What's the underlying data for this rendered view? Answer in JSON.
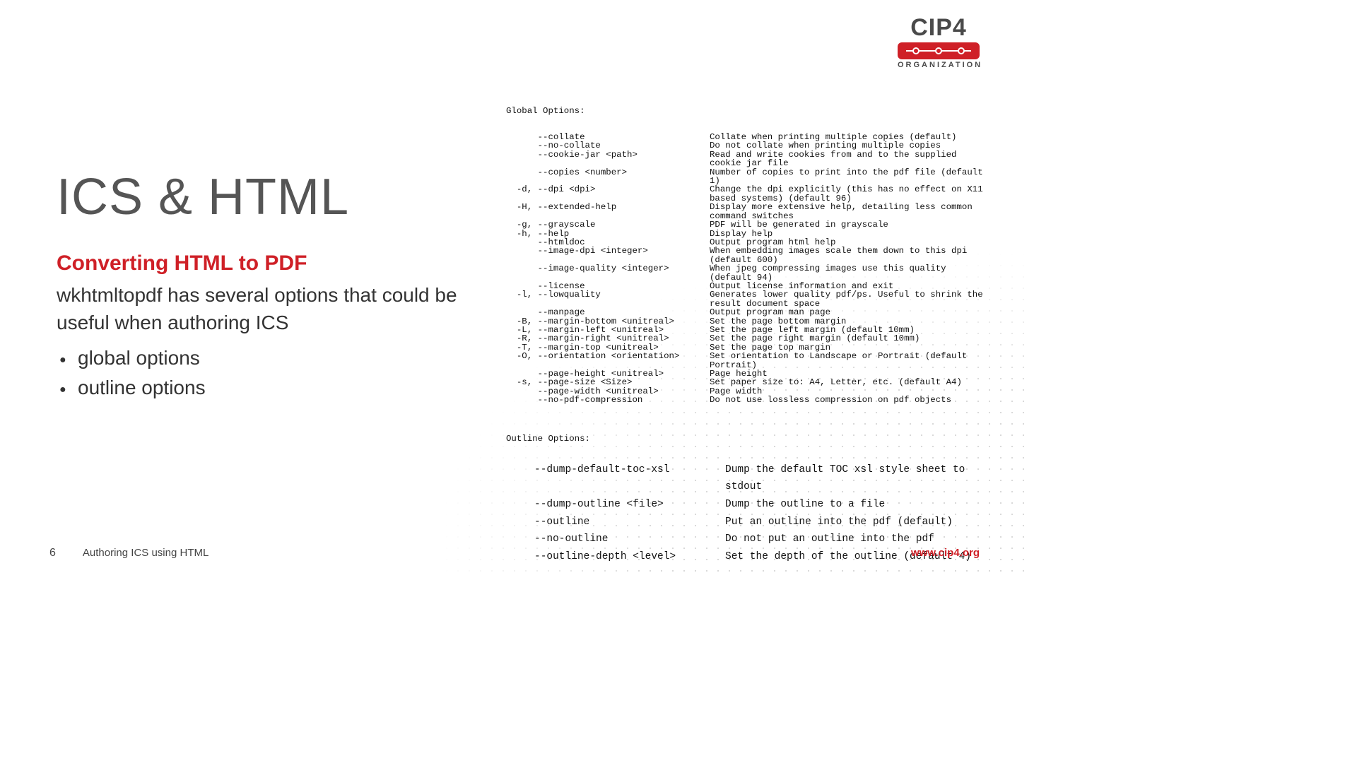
{
  "logo": {
    "top": "CIP4",
    "bottom": "ORGANIZATION"
  },
  "title": "ICS & HTML",
  "subtitle": "Converting HTML to PDF",
  "description": "wkhtmltopdf has several options that could be useful when authoring ICS",
  "bullets": [
    "global options",
    "outline options"
  ],
  "global_header": "Global Options:",
  "global_options": [
    {
      "sw": "      --collate",
      "ds": "Collate when printing multiple copies (default)"
    },
    {
      "sw": "      --no-collate",
      "ds": "Do not collate when printing multiple copies"
    },
    {
      "sw": "      --cookie-jar <path>",
      "ds": "Read and write cookies from and to the supplied cookie jar file"
    },
    {
      "sw": "      --copies <number>",
      "ds": "Number of copies to print into the pdf file (default 1)"
    },
    {
      "sw": "  -d, --dpi <dpi>",
      "ds": "Change the dpi explicitly (this has no effect on X11 based systems) (default 96)"
    },
    {
      "sw": "  -H, --extended-help",
      "ds": "Display more extensive help, detailing less common command switches"
    },
    {
      "sw": "  -g, --grayscale",
      "ds": "PDF will be generated in grayscale"
    },
    {
      "sw": "  -h, --help",
      "ds": "Display help"
    },
    {
      "sw": "      --htmldoc",
      "ds": "Output program html help"
    },
    {
      "sw": "      --image-dpi <integer>",
      "ds": "When embedding images scale them down to this dpi (default 600)"
    },
    {
      "sw": "      --image-quality <integer>",
      "ds": "When jpeg compressing images use this quality (default 94)"
    },
    {
      "sw": "      --license",
      "ds": "Output license information and exit"
    },
    {
      "sw": "  -l, --lowquality",
      "ds": "Generates lower quality pdf/ps. Useful to shrink the result document space"
    },
    {
      "sw": "      --manpage",
      "ds": "Output program man page"
    },
    {
      "sw": "  -B, --margin-bottom <unitreal>",
      "ds": "Set the page bottom margin"
    },
    {
      "sw": "  -L, --margin-left <unitreal>",
      "ds": "Set the page left margin (default 10mm)"
    },
    {
      "sw": "  -R, --margin-right <unitreal>",
      "ds": "Set the page right margin (default 10mm)"
    },
    {
      "sw": "  -T, --margin-top <unitreal>",
      "ds": "Set the page top margin"
    },
    {
      "sw": "  -O, --orientation <orientation>",
      "ds": "Set orientation to Landscape or Portrait (default Portrait)"
    },
    {
      "sw": "      --page-height <unitreal>",
      "ds": "Page height"
    },
    {
      "sw": "  -s, --page-size <Size>",
      "ds": "Set paper size to: A4, Letter, etc. (default A4)"
    },
    {
      "sw": "      --page-width <unitreal>",
      "ds": "Page width"
    },
    {
      "sw": "      --no-pdf-compression",
      "ds": "Do not use lossless compression on pdf objects"
    }
  ],
  "outline_header": "Outline Options:",
  "outline_options": [
    {
      "sw": "--dump-default-toc-xsl",
      "ds": "Dump the default TOC xsl style sheet to stdout"
    },
    {
      "sw": "--dump-outline <file>",
      "ds": "Dump the outline to a file"
    },
    {
      "sw": "--outline",
      "ds": "Put an outline into the pdf (default)"
    },
    {
      "sw": "--no-outline",
      "ds": "Do not put an outline into the pdf"
    },
    {
      "sw": "--outline-depth <level>",
      "ds": "Set the depth of the outline (default 4)"
    }
  ],
  "footer": {
    "page": "6",
    "title": "Authoring ICS using HTML",
    "url": "www.cip4.org"
  }
}
